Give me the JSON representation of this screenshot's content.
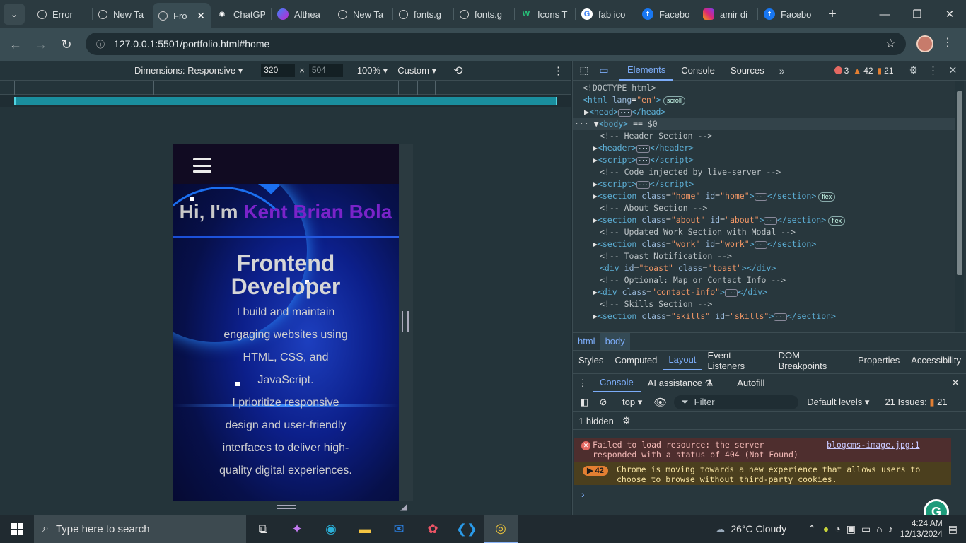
{
  "tabs": [
    {
      "title": "Error",
      "icon": "globe-icon"
    },
    {
      "title": "New Ta",
      "icon": "globe-icon"
    },
    {
      "title": "Fro",
      "icon": "globe-icon",
      "active": true
    },
    {
      "title": "ChatGP",
      "icon": "chatgpt-icon"
    },
    {
      "title": "Althea",
      "icon": "messenger-icon"
    },
    {
      "title": "New Ta",
      "icon": "globe-icon"
    },
    {
      "title": "fonts.g",
      "icon": "globe-icon"
    },
    {
      "title": "fonts.g",
      "icon": "globe-icon"
    },
    {
      "title": "Icons T",
      "icon": "w-icon"
    },
    {
      "title": "fab ico",
      "icon": "google-icon"
    },
    {
      "title": "Facebo",
      "icon": "facebook-icon"
    },
    {
      "title": "amir di",
      "icon": "instagram-icon"
    },
    {
      "title": "Facebo",
      "icon": "facebook-icon"
    }
  ],
  "address": {
    "url": "127.0.0.1:5501/portfolio.html#home"
  },
  "device_toolbar": {
    "dimensions_label": "Dimensions: Responsive",
    "width": "320",
    "height": "504",
    "zoom": "100%",
    "throttle": "Custom"
  },
  "page": {
    "hero_greeting": "Hi, I'm ",
    "hero_name": "Kent Brian Bola",
    "hero_role": "Frontend Developer",
    "hero_desc1": "I build and maintain engaging websites using HTML, CSS, and JavaScript.",
    "hero_desc2": "I prioritize responsive design and user-friendly interfaces to deliver high-quality digital experiences."
  },
  "devtools": {
    "tabs": [
      "Elements",
      "Console",
      "Sources"
    ],
    "errors": "3",
    "warnings": "42",
    "issues": "21",
    "crumbs": [
      "html",
      "body"
    ],
    "subtabs": [
      "Styles",
      "Computed",
      "Layout",
      "Event Listeners",
      "DOM Breakpoints",
      "Properties",
      "Accessibility"
    ],
    "drawer_tabs": [
      "Console",
      "AI assistance",
      "Autofill"
    ],
    "context": "top",
    "filter_placeholder": "Filter",
    "levels": "Default levels",
    "issues_label": "21 Issues:",
    "issues_count": "21",
    "hidden": "1 hidden",
    "error_msg": "Failed to load resource: the server responded with a status of 404 (Not Found)",
    "error_link": "blogcms-image.jpg:1",
    "warn_count": "42",
    "warn_msg": "Chrome is moving towards a new experience that allows users to choose to browse without third-party cookies."
  },
  "taskbar": {
    "search_placeholder": "Type here to search",
    "weather": "26°C  Cloudy",
    "time": "4:24 AM",
    "date": "12/13/2024"
  },
  "colors": {
    "accent": "#7cacf8",
    "name_accent": "#7a23c9",
    "mq_bar": "#1a8e9e"
  }
}
